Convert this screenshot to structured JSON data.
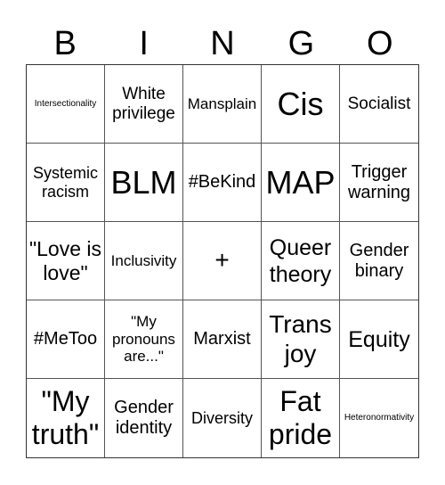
{
  "header": [
    "B",
    "I",
    "N",
    "G",
    "O"
  ],
  "cells": [
    "Intersectionality",
    "White privilege",
    "Mansplain",
    "Cis",
    "Socialist",
    "Systemic racism",
    "BLM",
    "#BeKind",
    "MAP",
    "Trigger warning",
    "\"Love is love\"",
    "Inclusivity",
    "+",
    "Queer theory",
    "Gender binary",
    "#MeToo",
    "\"My pronouns are...\"",
    "Marxist",
    "Trans joy",
    "Equity",
    "\"My truth\"",
    "Gender identity",
    "Diversity",
    "Fat pride",
    "Heteronormativity"
  ]
}
